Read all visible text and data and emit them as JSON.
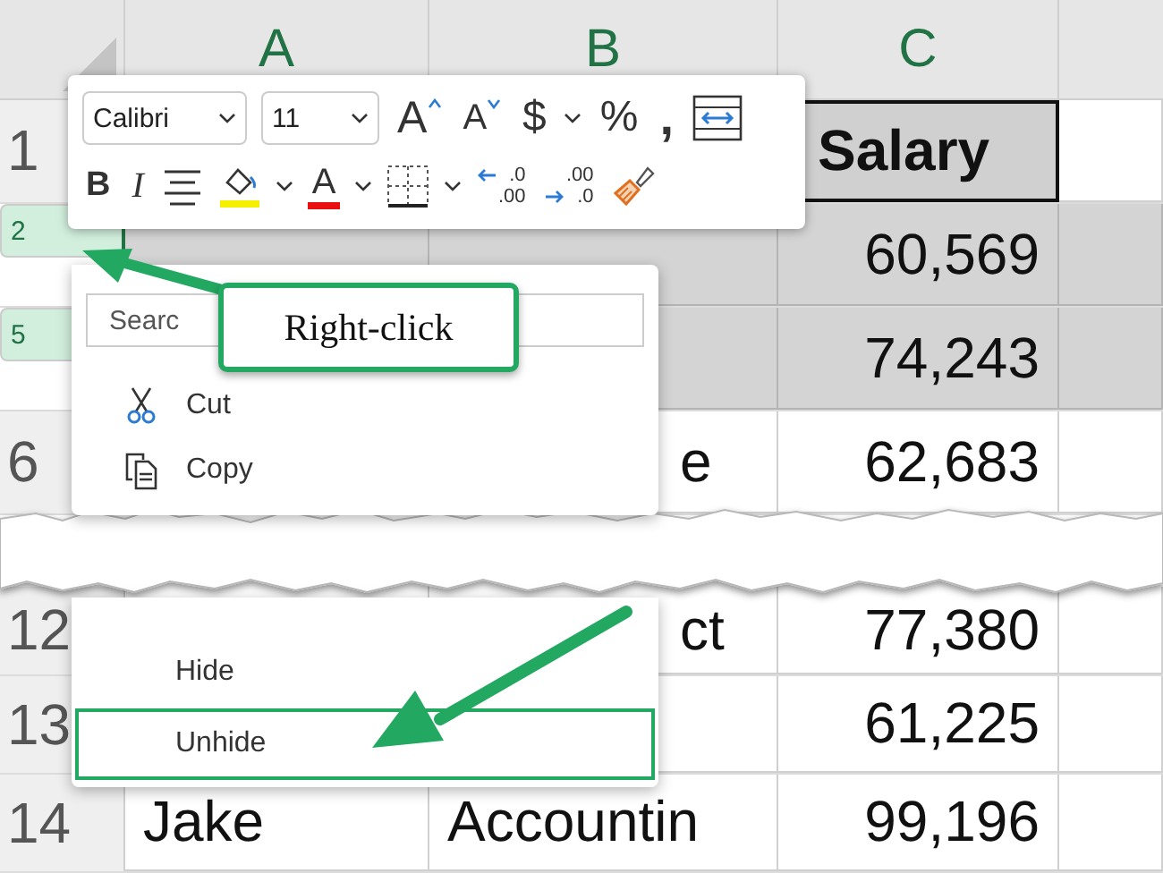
{
  "columns": [
    "A",
    "B",
    "C"
  ],
  "rows": [
    {
      "number": "1",
      "selected": false,
      "c": {
        "kind": "header",
        "text": "Salary"
      }
    },
    {
      "number": "2",
      "selected": true,
      "c": {
        "kind": "number",
        "text": "60,569"
      }
    },
    {
      "number": "5",
      "selected": true,
      "c": {
        "kind": "number",
        "text": "74,243"
      }
    },
    {
      "number": "6",
      "selected": false,
      "b": {
        "kind": "tail",
        "text": "e"
      },
      "c": {
        "kind": "number",
        "text": "62,683"
      }
    }
  ],
  "rows_after_break": [
    {
      "number": "12",
      "selected": false,
      "b": {
        "kind": "tail",
        "text": "ct"
      },
      "c": {
        "kind": "number",
        "text": "77,380"
      }
    },
    {
      "number": "13",
      "selected": false,
      "c": {
        "kind": "number",
        "text": "61,225"
      }
    },
    {
      "number": "14",
      "selected": false,
      "a": {
        "kind": "text",
        "text": "Jake"
      },
      "b": {
        "kind": "text",
        "text": "Accountin"
      },
      "c": {
        "kind": "number",
        "text": "99,196"
      }
    }
  ],
  "toolbar": {
    "upper_tools": [
      {
        "kind": "select",
        "text": "Calibri"
      },
      {
        "kind": "select",
        "text": "11"
      },
      {
        "kind": "grow",
        "text": "A"
      },
      {
        "kind": "shrink",
        "text": "A"
      },
      {
        "kind": "glyph",
        "text": "$"
      },
      {
        "kind": "caret"
      },
      {
        "kind": "glyph",
        "text": "%"
      },
      {
        "kind": "comma",
        "text": ","
      },
      {
        "kind": "wrap"
      }
    ],
    "lower_tools": [
      {
        "kind": "bold",
        "text": "B"
      },
      {
        "kind": "italic",
        "text": "I"
      },
      {
        "kind": "align"
      },
      {
        "kind": "fill"
      },
      {
        "kind": "caret"
      },
      {
        "kind": "fontcolor",
        "text": "A"
      },
      {
        "kind": "caret"
      },
      {
        "kind": "borders"
      },
      {
        "kind": "caret"
      },
      {
        "kind": "decimal_increase",
        "top": ".0",
        "bottom": ".00"
      },
      {
        "kind": "decimal_decrease",
        "top": ".00",
        "bottom": ".0"
      },
      {
        "kind": "brush"
      }
    ]
  },
  "context_menu": {
    "search": {
      "placeholder": "Searc"
    },
    "items": [
      {
        "kind": "cut",
        "label": "Cut",
        "selected": false
      },
      {
        "kind": "copy",
        "label": "Copy",
        "selected": false
      }
    ],
    "items_after_break": [
      {
        "label": "Hide",
        "selected": false
      },
      {
        "label": "Unhide",
        "selected": true
      }
    ]
  },
  "callout": {
    "text": "Right-click"
  }
}
